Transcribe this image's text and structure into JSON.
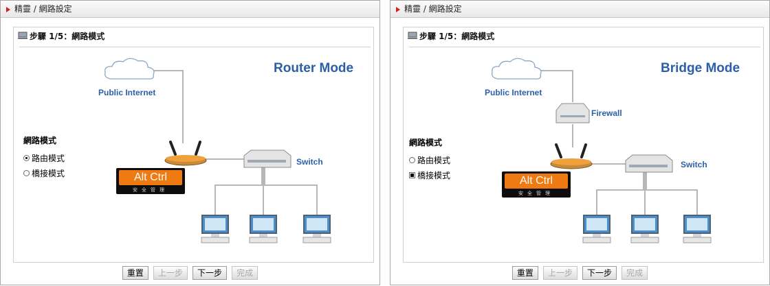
{
  "left": {
    "breadcrumb": "精靈 / 網路設定",
    "step_title": "步驟 1/5：網路模式",
    "mode_title": "Router Mode",
    "network_labels": {
      "internet": "Public Internet",
      "switch": "Switch"
    },
    "radio": {
      "title": "網路模式",
      "options": [
        {
          "label": "路由模式",
          "checked": true
        },
        {
          "label": "橋接模式",
          "checked": false
        }
      ]
    },
    "logo": {
      "text": "Alt Ctrl",
      "subtitle": "安全管理"
    },
    "buttons": [
      {
        "label": "重置",
        "enabled": true
      },
      {
        "label": "上一步",
        "enabled": false
      },
      {
        "label": "下一步",
        "enabled": true
      },
      {
        "label": "完成",
        "enabled": false
      }
    ]
  },
  "right": {
    "breadcrumb": "精靈 / 網路設定",
    "step_title": "步驟 1/5：網路模式",
    "mode_title": "Bridge Mode",
    "network_labels": {
      "internet": "Public Internet",
      "firewall": "Firewall",
      "switch": "Switch"
    },
    "radio": {
      "title": "網路模式",
      "options": [
        {
          "label": "路由模式",
          "checked": false
        },
        {
          "label": "橋接模式",
          "checked": true
        }
      ]
    },
    "logo": {
      "text": "Alt Ctrl",
      "subtitle": "安全管理"
    },
    "buttons": [
      {
        "label": "重置",
        "enabled": true
      },
      {
        "label": "上一步",
        "enabled": false
      },
      {
        "label": "下一步",
        "enabled": true
      },
      {
        "label": "完成",
        "enabled": false
      }
    ]
  },
  "colors": {
    "accent_blue": "#2b5fa8",
    "arrow_red": "#d21e1e",
    "logo_orange": "#f07a12"
  }
}
